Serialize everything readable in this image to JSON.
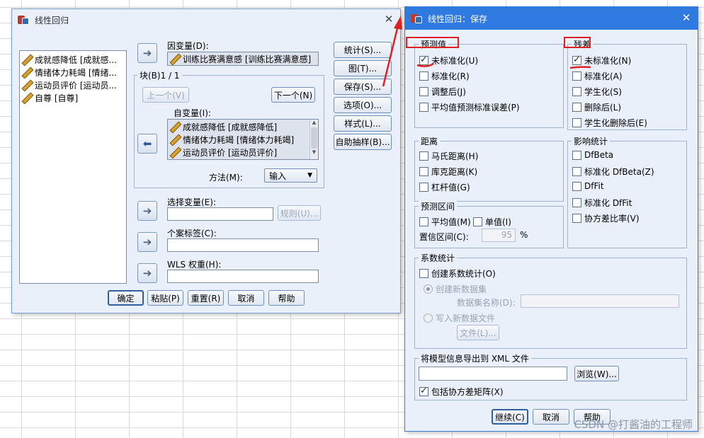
{
  "left_dialog": {
    "title": "线性回归",
    "variables": [
      "成就感降低 [成就感...",
      "情绪体力耗竭 [情绪...",
      "运动员评价 [运动员...",
      "自尊 [自尊]"
    ],
    "dependent_label": "因变量(D):",
    "dependent_value": "训练比赛满意感 [训练比赛满意感]",
    "block_label": "块(B)1 / 1",
    "prev_btn": "上一个(V)",
    "next_btn": "下一个(N)",
    "independent_label": "自变量(I):",
    "independent_items": [
      "成就感降低 [成就感降低]",
      "情绪体力耗竭 [情绪体力耗竭]",
      "运动员评价 [运动员评价]"
    ],
    "method_label": "方法(M):",
    "method_value": "输入",
    "selection_label": "选择变量(E):",
    "rule_btn": "规则(U)...",
    "case_label": "个案标签(C):",
    "wls_label": "WLS 权重(H):",
    "side_buttons": [
      "统计(S)...",
      "图(T)...",
      "保存(S)...",
      "选项(O)...",
      "样式(L)...",
      "自助抽样(B)..."
    ],
    "bottom_buttons": [
      "确定",
      "粘贴(P)",
      "重置(R)",
      "取消",
      "帮助"
    ]
  },
  "save_dialog": {
    "title": "线性回归：保存",
    "predicted": {
      "title": "预测值",
      "items": [
        {
          "label": "未标准化(U)",
          "checked": true
        },
        {
          "label": "标准化(R)",
          "checked": false
        },
        {
          "label": "调整后(J)",
          "checked": false
        },
        {
          "label": "平均值预测标准误差(P)",
          "checked": false
        }
      ]
    },
    "residuals": {
      "title": "残差",
      "items": [
        {
          "label": "未标准化(N)",
          "checked": true
        },
        {
          "label": "标准化(A)",
          "checked": false
        },
        {
          "label": "学生化(S)",
          "checked": false
        },
        {
          "label": "删除后(L)",
          "checked": false
        },
        {
          "label": "学生化删除后(E)",
          "checked": false
        }
      ]
    },
    "distance": {
      "title": "距离",
      "items": [
        "马氏距离(H)",
        "库克距离(K)",
        "杠杆值(G)"
      ]
    },
    "influence": {
      "title": "影响统计",
      "items": [
        "DfBeta",
        "标准化 DfBeta(Z)",
        "DfFit",
        "标准化 DfFit",
        "协方差比率(V)"
      ]
    },
    "interval": {
      "title": "预测区间",
      "mean": "平均值(M)",
      "individual": "单值(I)",
      "ci_label": "置信区间(C):",
      "ci_value": "95",
      "pct": "%"
    },
    "coef": {
      "title": "系数统计",
      "create": "创建系数统计(O)",
      "new_dataset": "创建新数据集",
      "dataset_name": "数据集名称(D):",
      "write_file": "写入新数据文件",
      "file_btn": "文件(L)..."
    },
    "export": {
      "title": "将模型信息导出到 XML 文件",
      "browse": "浏览(W)...",
      "include": "包括协方差矩阵(X)"
    },
    "buttons": [
      "继续(C)",
      "取消",
      "帮助"
    ]
  },
  "watermark": "CSDN @打酱油的工程师",
  "colors": {
    "annotation": "#e02020",
    "dialog_bg": "#e9f0fa",
    "border": "#7a9cc9"
  }
}
